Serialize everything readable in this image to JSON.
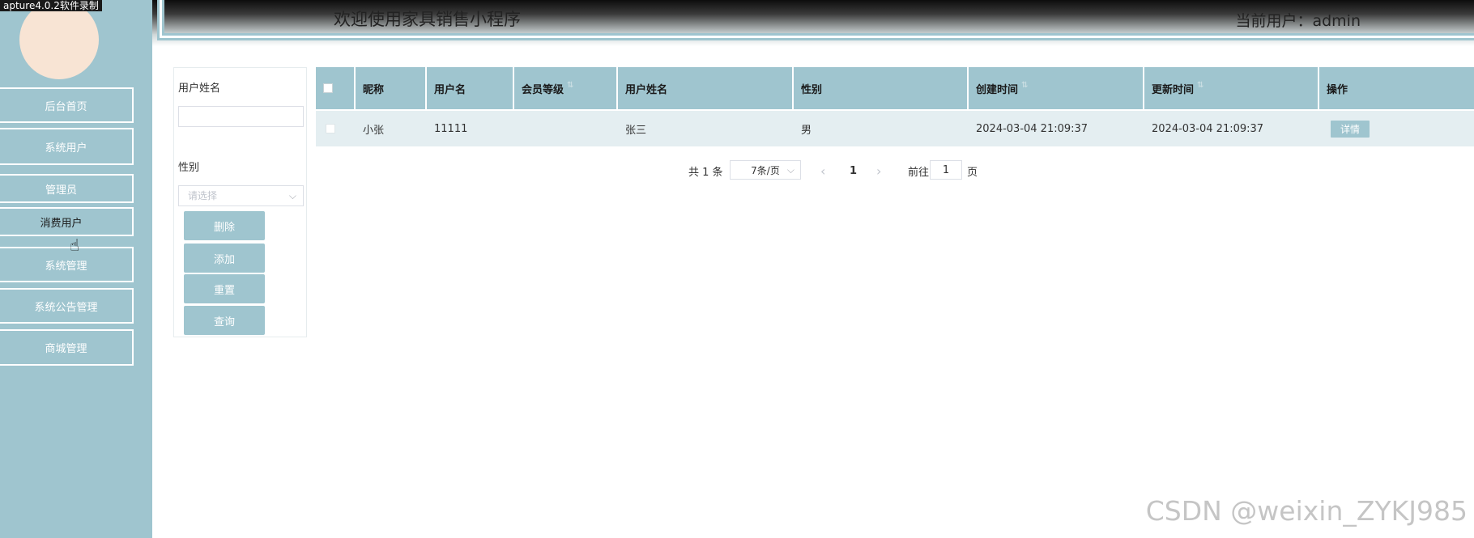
{
  "recording_banner": "apture4.0.2软件录制",
  "header": {
    "title": "欢迎使用家具销售小程序",
    "current_user": "当前用户：admin"
  },
  "sidebar": {
    "items": [
      {
        "label": "后台首页"
      },
      {
        "label": "系统用户"
      },
      {
        "label": "管理员"
      },
      {
        "label": "消费用户"
      },
      {
        "label": "系统管理"
      },
      {
        "label": "系统公告管理"
      },
      {
        "label": "商城管理"
      }
    ]
  },
  "filter": {
    "name_label": "用户姓名",
    "name_value": "",
    "gender_label": "性别",
    "gender_placeholder": "请选择",
    "buttons": {
      "delete": "删除",
      "add": "添加",
      "reset": "重置",
      "query": "查询"
    }
  },
  "table": {
    "headers": [
      "昵称",
      "用户名",
      "会员等级",
      "用户姓名",
      "性别",
      "创建时间",
      "更新时间",
      "操作"
    ],
    "rows": [
      {
        "nickname": "小张",
        "username": "11111",
        "level": "",
        "realname": "张三",
        "gender": "男",
        "created": "2024-03-04 21:09:37",
        "updated": "2024-03-04 21:09:37",
        "action": "详情"
      }
    ]
  },
  "pagination": {
    "total": "共 1 条",
    "page_size": "7条/页",
    "prev": "‹",
    "current_page": "1",
    "next": "›",
    "goto_label": "前往",
    "goto_value": "1",
    "page_suffix": "页"
  },
  "watermark": "CSDN @weixin_ZYKJ985",
  "colors": {
    "accent": "#9fc5cf",
    "row_bg": "#e4eef1",
    "avatar": "#f8e4d4"
  },
  "icons": {
    "cursor": "pointer-hand-icon",
    "select_chevron": "chevron-down-icon"
  }
}
